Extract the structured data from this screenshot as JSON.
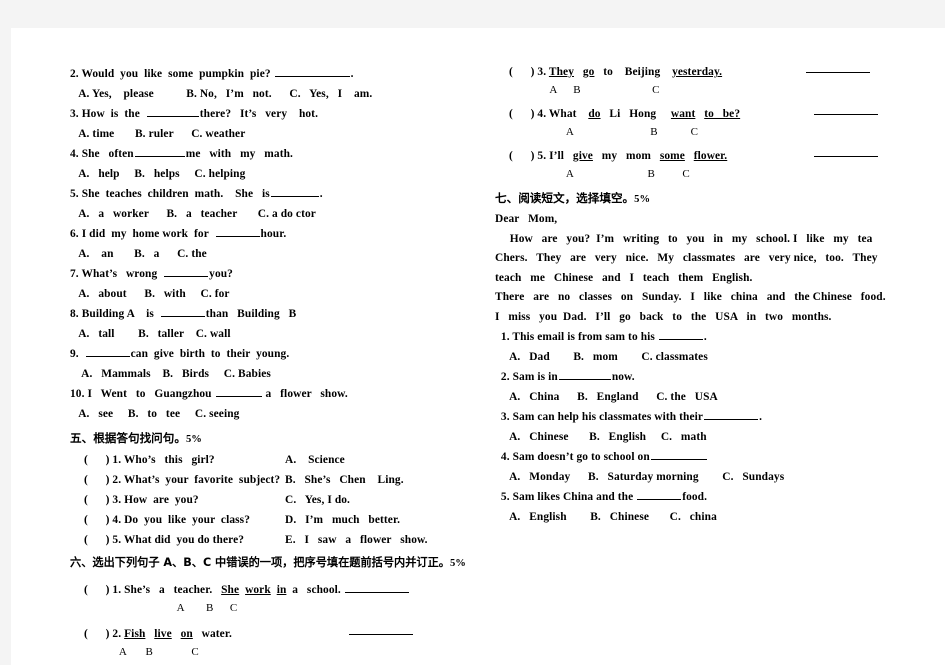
{
  "document": {
    "type": "english-exam-worksheet",
    "left_column": {
      "multiple_choice_continued": [
        {
          "id": "q2",
          "stem_pre": "2. Would  you  like  some  pumpkin  pie? ",
          "stem_blank": 75,
          "stem_post": ".",
          "options": "   A. Yes,    please           B. No,   I’m   not.      C.   Yes,   I    am."
        },
        {
          "id": "q3",
          "stem_pre": "3. How  is  the  ",
          "stem_blank": 52,
          "stem_post": "there?   It’s   very    hot.",
          "options": "   A. time       B. ruler      C. weather"
        },
        {
          "id": "q4",
          "stem_pre": "4. She   often",
          "stem_blank": 50,
          "stem_post": "me   with   my   math.",
          "options": "   A.   help     B.   helps     C. helping"
        },
        {
          "id": "q5",
          "stem_pre": "5. She  teaches  children  math.    She   is",
          "stem_blank": 48,
          "stem_post": ".",
          "options": "   A.   a   worker      B.   a   teacher       C. a do ctor"
        },
        {
          "id": "q6",
          "stem_pre": "6. I did  my  home work  for  ",
          "stem_blank": 44,
          "stem_post": "hour.",
          "options": "   A.    an       B.   a      C. the"
        },
        {
          "id": "q7",
          "stem_pre": "7. What’s   wrong  ",
          "stem_blank": 44,
          "stem_post": "you?",
          "options": "   A.   about      B.   with     C. for"
        },
        {
          "id": "q8",
          "stem_pre": "8. Building A    is  ",
          "stem_blank": 44,
          "stem_post": "than   Building   B",
          "options": "   A.   tall        B.   taller    C. wall"
        },
        {
          "id": "q9",
          "stem_pre": "9.  ",
          "stem_blank": 44,
          "stem_post": "can  give  birth  to  their  young.",
          "options": "    A.   Mammals    B.   Birds     C. Babies"
        },
        {
          "id": "q10",
          "stem_pre": "10. I   Went   to   Guangzhou ",
          "stem_blank": 46,
          "stem_post": " a   flower   show.",
          "options": "   A.   see     B.   to   tee     C. seeing"
        }
      ],
      "section_five": {
        "heading_cn": "五、根据答句找问句。",
        "heading_score": "5%",
        "items": [
          {
            "bracket": "(      ) 1. Who’s   this   girl?",
            "answer": "A.    Science"
          },
          {
            "bracket": "(      ) 2. What’s  your  favorite  subject?",
            "answer": "B.   She’s   Chen    Ling."
          },
          {
            "bracket": "(      ) 3. How  are  you?",
            "answer": "C.   Yes, I do."
          },
          {
            "bracket": "(      ) 4. Do  you  like  your  class?",
            "answer": "D.   I’m   much   better."
          },
          {
            "bracket": "(      ) 5. What did  you do there?",
            "answer": "E.   I   saw   a   flower   show."
          }
        ]
      },
      "section_six": {
        "heading_cn": "六、选出下列句子 A、B、C 中错误的一项，把序号填在题前括号内并订正。",
        "heading_score": "5%",
        "items": [
          {
            "bracket": "(      ) 1. She’s   a   teacher.   ",
            "u1": "She",
            "mid1": "  ",
            "u2": "work",
            "mid2": "  ",
            "u3": "in",
            "tail": "  a   school. ",
            "marks": "                                       A        B      C"
          },
          {
            "bracket": "(      ) 2. ",
            "u1": "Fish",
            "mid1": "   ",
            "u2": "live",
            "mid2": "   ",
            "u3": "on",
            "tail": "   water.",
            "marks": "                  A       B              C"
          }
        ]
      }
    },
    "right_column": {
      "section_six_continued": [
        {
          "bracket": "(      ) 3. ",
          "u1": "They",
          "mid1": "   ",
          "plain1": "go",
          "mid2": "   to    Beijing    ",
          "u3": "yesterday.",
          "marks": "                    A      B                          C"
        },
        {
          "bracket": "(      ) 4. What    ",
          "u1": "do",
          "mid1": "   Li   Hong     ",
          "u2": "want",
          "mid2": "   ",
          "u3": "to   be?",
          "marks": "                          A                            B            C"
        },
        {
          "bracket": "(      ) 5. I’ll   ",
          "u1": "give",
          "mid1": "   my   mom   ",
          "u2": "some",
          "mid2": "   ",
          "u3": "flower.",
          "marks": "                          A                           B          C"
        }
      ],
      "section_seven": {
        "heading_cn": "七、阅读短文，选择填空。",
        "heading_score": "5%",
        "passage": [
          "Dear   Mom,",
          "     How   are   you?  I’m   writing   to   you   in   my   school. I   like   my   tea",
          "Chers.   They   are   very   nice.   My   classmates   are   very nice,   too.   They",
          "teach   me   Chinese   and   I   teach   them   English.",
          "There   are   no   classes   on   Sunday.   I   like   china   and   the Chinese   food.",
          "I   miss   you  Dad.   I’ll   go   back   to   the   USA   in   two   months."
        ],
        "questions": [
          {
            "stem_pre": "  1. This email is from sam to his ",
            "stem_blank": 44,
            "stem_post": ".",
            "options": "     A.   Dad        B.   mom        C. classmates"
          },
          {
            "stem_pre": "  2. Sam is in",
            "stem_blank": 52,
            "stem_post": "now.",
            "options": "     A.   China      B.   England      C. the   USA"
          },
          {
            "stem_pre": "  3. Sam can help his classmates with their",
            "stem_blank": 54,
            "stem_post": ".",
            "options": "     A.   Chinese       B.   English     C.   math"
          },
          {
            "stem_pre": "  4. Sam doesn’t go to school on",
            "stem_blank": 56,
            "stem_post": "",
            "options": "     A.   Monday      B.   Saturday morning        C.   Sundays"
          },
          {
            "stem_pre": "  5. Sam likes China and the ",
            "stem_blank": 44,
            "stem_post": "food.",
            "options": "     A.   English        B.   Chinese       C.   china"
          }
        ]
      }
    }
  }
}
